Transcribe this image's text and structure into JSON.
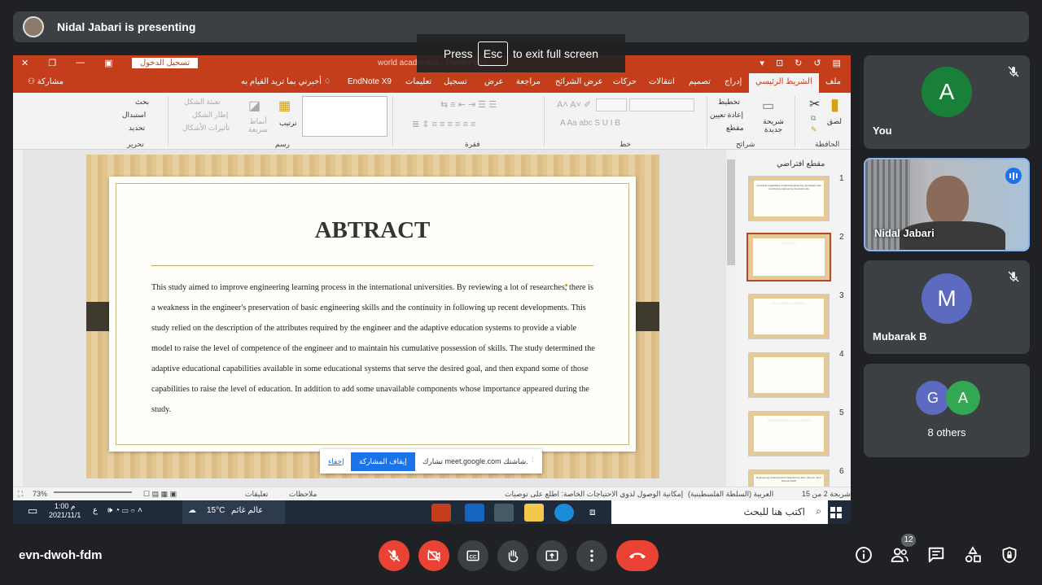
{
  "topbar": {
    "presenter_text": "Nidal Jabari is presenting"
  },
  "overlay": {
    "press": "Press",
    "key": "Esc",
    "rest": "to exit full screen"
  },
  "ppt": {
    "signin": "تسجيل الدخول",
    "filename": "world academics  -  PowerPoint",
    "tabs": [
      "ملف",
      "الشريط الرئيسي",
      "إدراج",
      "تصميم",
      "انتقالات",
      "حركات",
      "عرض الشرائح",
      "مراجعة",
      "عرض",
      "تسجيل",
      "تعليمات",
      "EndNote X9",
      "أخبرني بما تريد القيام به"
    ],
    "share": "مشاركة",
    "ribbon": {
      "clipboard": "الحافظة",
      "paste": "لصق",
      "slides": "شرائح",
      "new_slide": "شريحة جديدة",
      "layout": "تخطيط",
      "reset": "إعادة تعيين",
      "section": "مقطع",
      "font": "خط",
      "paragraph": "فقرة",
      "drawing": "رسم",
      "arrange": "ترتيب",
      "quick_styles": "أنماط سريعة",
      "shape_fill": "تعبئة الشكل",
      "shape_outline": "إطار الشكل",
      "shape_effects": "تأثيرات الأشكال",
      "editing": "تحرير",
      "find": "بحث",
      "replace": "استبدال",
      "select": "تحديد"
    },
    "slide": {
      "title": "ABTRACT",
      "body": "This study aimed to improve engineering learning process in the international universities. By reviewing a lot of researches, there is a weakness in the engineer's preservation of basic engineering skills and the continuity in following up   recent developments. This study relied on the description of the attributes required by the engineer and the adaptive education systems to provide a viable model to raise the level of competence of the engineer and to maintain his cumulative possession of skills. The study determined the adaptive educational capabilities available in some educational systems that serve the desired goal, and then   expand some of those capabilities to raise the level of education. In addition to add some unavailable components whose importance appeared during the study."
    },
    "thumbs": {
      "section": "مقطع افتراضي",
      "numbers": [
        "1",
        "2",
        "3",
        "4",
        "5",
        "6"
      ],
      "t1": "Contrasts Capabilities of World Engineering candidates with continuing engineering developments",
      "t3": "ADAPTIVE LEARNING",
      "t5": "ENGINEERING EDUCATION",
      "t6": "Engineering Characteristics Required by EAC (Source: EAC Manual 2018)"
    },
    "status": {
      "slide_of": "شريحة 2 من 15",
      "lang": "العربية (السلطة الفلسطينية)",
      "accessibility": "إمكانية الوصول لذوي الاحتياجات الخاصة: اطلع على توصيات",
      "notes": "ملاحظات",
      "comments": "تعليقات",
      "zoom": "73%"
    },
    "taskbar": {
      "search": "اكتب هنا للبحث",
      "weather_text": "عالم غائم",
      "temp": "15°C",
      "time": "1:00 م",
      "date": "2021/11/1",
      "lang": "ع"
    }
  },
  "sharebar": {
    "text": "تشارك meet.google.com شاشتك.",
    "stop": "إيقاف المشاركة",
    "hide": "إخفاء"
  },
  "participants": [
    {
      "name": "You",
      "initial": "A",
      "color": "#188038"
    },
    {
      "name": "Nidal Jabari"
    },
    {
      "name": "Mubarak B",
      "initial": "M",
      "color": "#5c6bc0"
    },
    {
      "name": "8 others",
      "initials": [
        "G",
        "A"
      ],
      "colors": [
        "#5c6bc0",
        "#33a852"
      ]
    }
  ],
  "bottom": {
    "meeting_code": "evn-dwoh-fdm",
    "people_count": "12"
  }
}
